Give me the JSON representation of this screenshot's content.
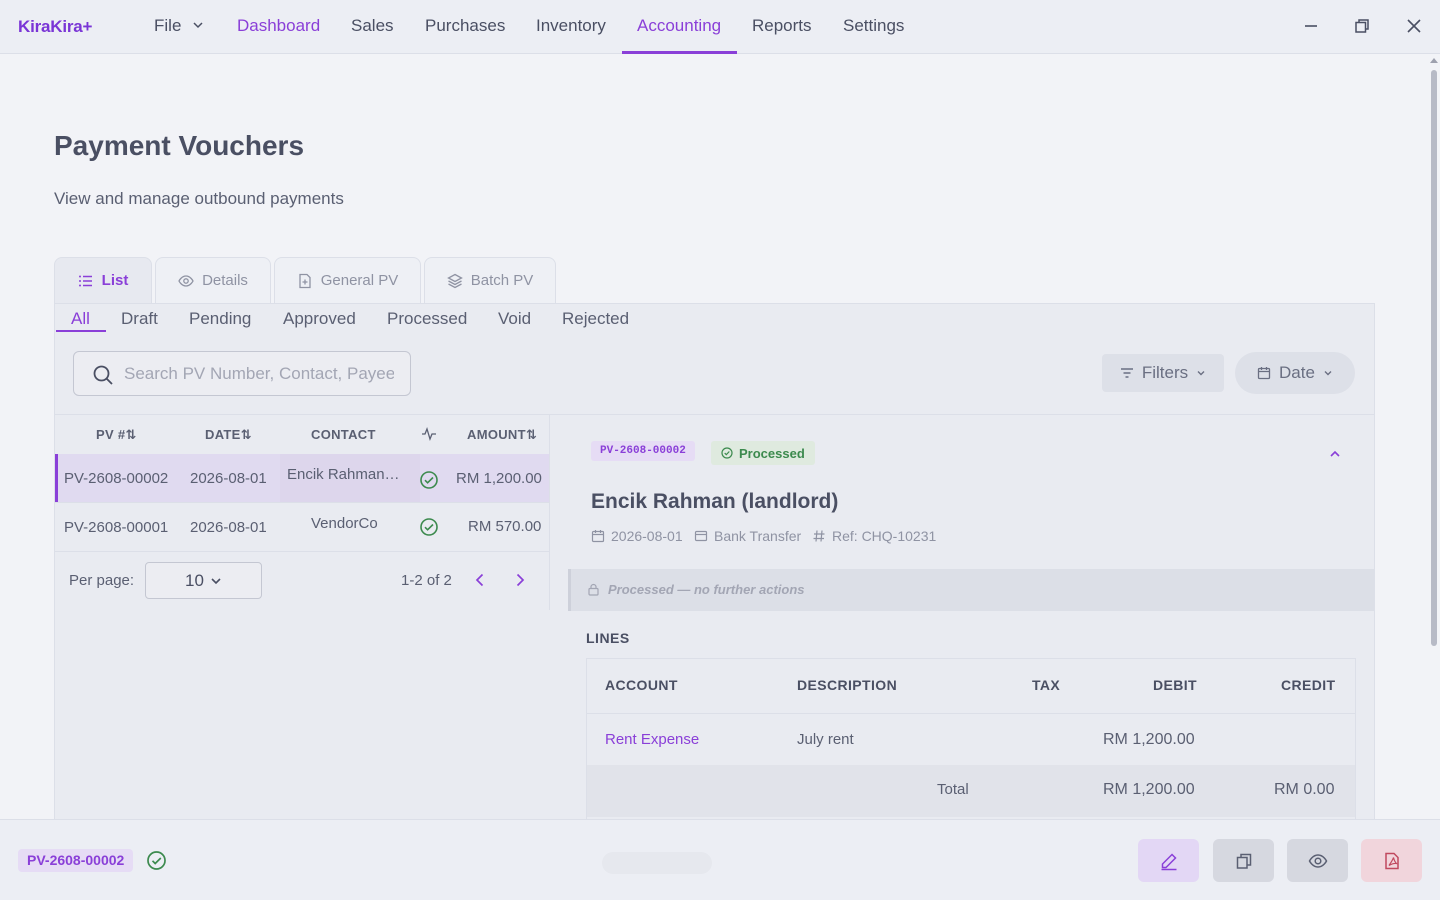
{
  "app": {
    "brand": "KiraKira+"
  },
  "nav": {
    "file": "File",
    "items": [
      "Dashboard",
      "Sales",
      "Purchases",
      "Inventory",
      "Accounting",
      "Reports",
      "Settings"
    ],
    "active": "Accounting"
  },
  "page": {
    "title": "Payment Vouchers",
    "subtitle": "View and manage outbound payments"
  },
  "view_tabs": [
    {
      "label": "List",
      "icon": "list-icon",
      "active": true
    },
    {
      "label": "Details",
      "icon": "eye-icon",
      "active": false
    },
    {
      "label": "General PV",
      "icon": "document-plus-icon",
      "active": false
    },
    {
      "label": "Batch PV",
      "icon": "layers-icon",
      "active": false
    }
  ],
  "status_tabs": [
    "All",
    "Draft",
    "Pending",
    "Approved",
    "Processed",
    "Void",
    "Rejected"
  ],
  "search": {
    "placeholder": "Search PV Number, Contact, Payee"
  },
  "toolbar": {
    "filters": "Filters",
    "date": "Date"
  },
  "list": {
    "columns": {
      "pv": "PV #",
      "date": "DATE",
      "contact": "CONTACT",
      "amount": "AMOUNT"
    },
    "rows": [
      {
        "pv": "PV-2608-00002",
        "date": "2026-08-01",
        "contact": "Encik Rahman…",
        "amount": "RM 1,200.00",
        "status": "processed",
        "selected": true
      },
      {
        "pv": "PV-2608-00001",
        "date": "2026-08-01",
        "contact": "VendorCo",
        "amount": "RM 570.00",
        "status": "processed",
        "selected": false
      }
    ],
    "per_page_label": "Per page:",
    "per_page_value": "10",
    "range": "1-2 of 2"
  },
  "detail": {
    "pv_number": "PV-2608-00002",
    "status": "Processed",
    "payee": "Encik Rahman (landlord)",
    "date": "2026-08-01",
    "method": "Bank Transfer",
    "ref": "Ref: CHQ-10231",
    "locked_note": "Processed — no further actions",
    "lines_title": "LINES",
    "lines_columns": {
      "account": "ACCOUNT",
      "description": "DESCRIPTION",
      "tax": "TAX",
      "debit": "DEBIT",
      "credit": "CREDIT"
    },
    "lines": [
      {
        "account": "Rent Expense",
        "description": "July rent",
        "tax": "",
        "debit": "RM 1,200.00",
        "credit": ""
      }
    ],
    "total": {
      "label": "Total",
      "debit": "RM 1,200.00",
      "credit": "RM 0.00"
    }
  },
  "footer": {
    "pv_number": "PV-2608-00002"
  },
  "colors": {
    "accent": "#8a3fd8",
    "success": "#3c8a4e",
    "danger": "#c0485e"
  }
}
